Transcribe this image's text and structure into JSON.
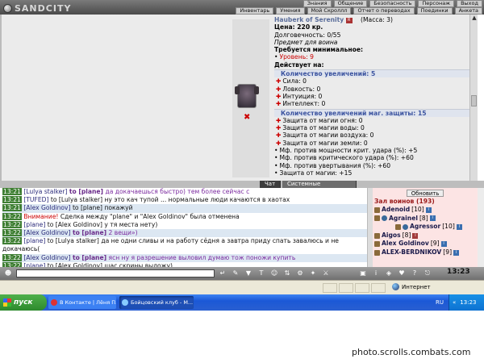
{
  "logo": "SANDCITY",
  "menu_top": [
    "Знания",
    "Общение",
    "Безопасность",
    "Персонаж",
    "Выход"
  ],
  "menu_bottom": [
    "Инвентарь",
    "Умения",
    "Мой Скроллл",
    "Отчет о переводах",
    "Поединки",
    "Анкета"
  ],
  "item": {
    "name": "Hauberk of Serenity",
    "mass": "(Масса: 3)",
    "lines": [
      {
        "kind": "bold",
        "text": "Цена: 220 кр."
      },
      {
        "kind": "plain",
        "text": "Долговечность: 0/55"
      },
      {
        "kind": "italic",
        "text": "Предмет для воина"
      },
      {
        "kind": "bold",
        "text": "Требуется минимальное:"
      },
      {
        "kind": "redbullet",
        "text": "Уровень: 9"
      },
      {
        "kind": "bold",
        "text": "Действует на:"
      },
      {
        "kind": "section",
        "text": "Количество увеличений: 5"
      },
      {
        "kind": "plus",
        "text": "Сила: 0"
      },
      {
        "kind": "plus",
        "text": "Ловкость: 0"
      },
      {
        "kind": "plus",
        "text": "Интуиция: 0"
      },
      {
        "kind": "plus",
        "text": "Интеллект: 0"
      },
      {
        "kind": "section",
        "text": "Количество увеличений маг. защиты: 15"
      },
      {
        "kind": "plus",
        "text": "Защита от магии огня: 0"
      },
      {
        "kind": "plus",
        "text": "Защита от магии воды: 0"
      },
      {
        "kind": "plus",
        "text": "Защита от магии воздуха: 0"
      },
      {
        "kind": "plus",
        "text": "Защита от магии земли: 0"
      },
      {
        "kind": "bullet",
        "text": "Мф. против мощности крит. удара (%): +5"
      },
      {
        "kind": "bullet",
        "text": "Мф. против критического удара (%): +60"
      },
      {
        "kind": "bullet",
        "text": "Мф. против увертывания (%): +60"
      },
      {
        "kind": "bullet",
        "text": "Защита от магии: +15"
      }
    ]
  },
  "tabs": {
    "chat": "Чат",
    "system": "Системные сообщения"
  },
  "chat": [
    {
      "time": "13:21",
      "sender": "[Lulya stalker]",
      "to": "to [plane]",
      "text": "да докачаешься быстро) тем более сейчас с",
      "style": "normal",
      "hl": false
    },
    {
      "time": "13:21",
      "sender": "[TUFED]",
      "to": "to [Lulya stalker]",
      "text": "ну это кач тупой ... нормальные люди качаются в хаотах",
      "style": "plainto",
      "hl": false
    },
    {
      "time": "13:21",
      "sender": "[Alex Goldinov]",
      "to": "to [plane]",
      "text": "покажуй",
      "style": "plainto",
      "hl": true
    },
    {
      "time": "13:22",
      "sender": "Внимание!",
      "to": "",
      "text": "Сделка между \"plane\" и \"Alex Goldinov\" была отменена",
      "style": "warn",
      "hl": false
    },
    {
      "time": "13:22",
      "sender": "[plane]",
      "to": "to [Alex Goldinov]",
      "text": "у тя места нету)",
      "style": "plainto",
      "hl": false
    },
    {
      "time": "13:22",
      "sender": "[Alex Goldinov]",
      "to": "to [plane]",
      "text": "2 вещи»)",
      "style": "normal",
      "hl": true
    },
    {
      "time": "13:22",
      "sender": "[plane]",
      "to": "to [Lulya stalker]",
      "text": "да не одни сливы и на работу сёдня а завтра приду спать завалюсь и не докачаюсь(",
      "style": "plainto",
      "hl": false,
      "wrap": true
    },
    {
      "time": "13:22",
      "sender": "[Alex Goldinov]",
      "to": "to [plane]",
      "text": "ясн ну я разрешение выловил думаю тож поножи купить",
      "style": "normal",
      "hl": true
    },
    {
      "time": "13:22",
      "sender": "[plane]",
      "to": "to [Alex Goldinov]",
      "text": "щас скрины выложу)",
      "style": "plainto",
      "hl": false
    },
    {
      "time": "13:23",
      "sender": "[Alex Goldinov]",
      "to": "to [plane]",
      "text": "+",
      "style": "normal",
      "hl": true
    }
  ],
  "players": {
    "refresh": "Обновить",
    "header": "Зал воинов (193)",
    "list": [
      {
        "name": "Adenoid",
        "lvl": "[10]",
        "badge": "i",
        "kind": "a"
      },
      {
        "name": "Agrainel",
        "lvl": "[8]",
        "badge": "i",
        "kind": "b"
      },
      {
        "name": "Agressor",
        "lvl": "[10]",
        "badge": "i",
        "kind": "c"
      },
      {
        "name": "Aigos",
        "lvl": "[8]",
        "badge": "i",
        "kind": "d"
      },
      {
        "name": "Alex Goldinov",
        "lvl": "[9]",
        "badge": "i",
        "kind": "e"
      },
      {
        "name": "ALEX-BERDNIKOV",
        "lvl": "[9]",
        "badge": "i",
        "kind": "e"
      }
    ]
  },
  "bottombar": {
    "clock": "13:23"
  },
  "statusbar": {
    "internet": "Интернет"
  },
  "taskbar": {
    "start": "пуск",
    "tasks": [
      "В Контакте | Лёня П...",
      "Бойцовский клуб - М..."
    ],
    "lang": "RU",
    "time": "13:23"
  },
  "credit": "photo.scrolls.combats.com"
}
